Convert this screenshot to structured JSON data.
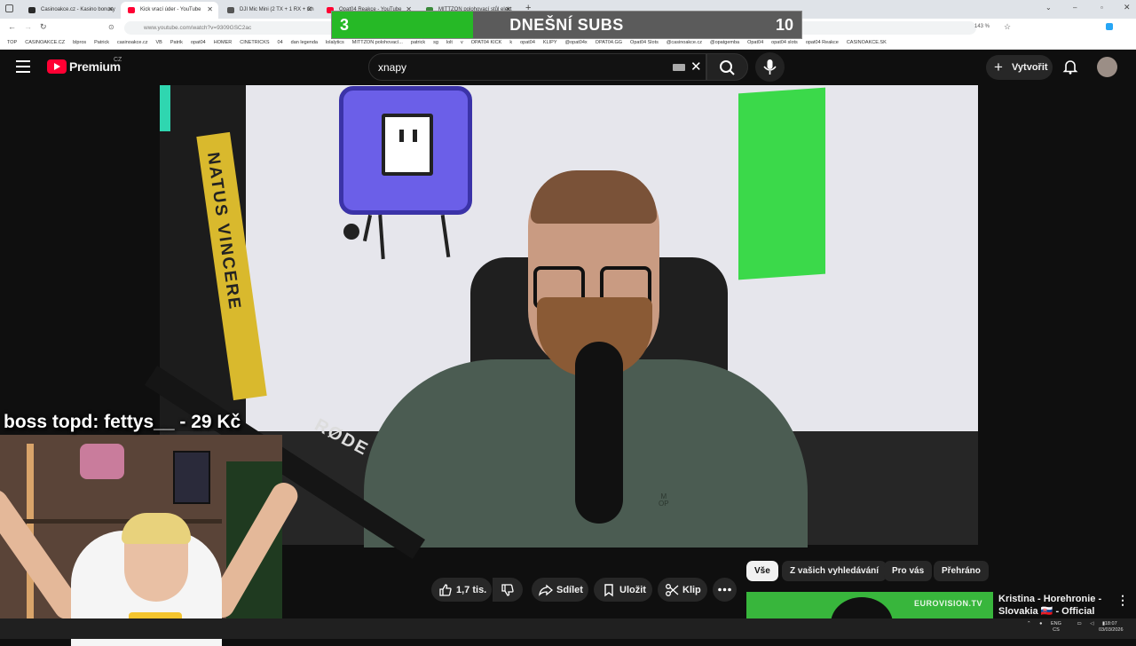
{
  "browser": {
    "tabs": [
      {
        "label": "Casinoakce.cz - Kasino bonusy",
        "color": "#2a2a2a"
      },
      {
        "label": "Kick vrací úder - YouTube",
        "color": "#ff0033"
      },
      {
        "label": "DJI Mic Mini (2 TX + 1 RX + Ch",
        "color": "#555555"
      },
      {
        "label": "Opat04 Reakce - YouTube",
        "color": "#ff0033"
      },
      {
        "label": "MITTZON polohovací stůl elekt",
        "color": "#3a8a3a"
      }
    ],
    "url": "www.youtube.com/watch?v=9309GSC2ac",
    "zoom": "143 %",
    "bookmarks": [
      "TOP",
      "CASINOAKCE.CZ",
      "blpros",
      "Patrick",
      "casinoakce.cz",
      "VB",
      "Patrik",
      "opat04",
      "HOMER",
      "CINETRICKS",
      "04",
      "dan legenda",
      "lolalytics",
      "MITTZON polohovací...",
      "patrick",
      "sg",
      "lolt",
      "v",
      "OPAT04 KICK",
      "k",
      "opat04",
      "KLIPY",
      "@opat04x",
      "OPAT04.GG",
      "Opat04 Slots",
      "@casinoakce.cz",
      "@opatgemba",
      "Opat04",
      "opat04 slots",
      "opat04 Reakce",
      "CASINOAKCE.SK"
    ]
  },
  "overlay": {
    "current": "3",
    "title": "DNEŠNÍ SUBS",
    "goal": "10",
    "progress_fraction": 0.3,
    "progress_color": "#26b926",
    "donation": "boss topd:  fettys__ - 29 Kč"
  },
  "youtube": {
    "brand": "Premium",
    "region": "CZ",
    "search_value": "xnapy",
    "create_label": "Vytvořit",
    "actions": {
      "likes": "1,7 tis.",
      "share": "Sdílet",
      "save": "Uložit",
      "clip": "Klip"
    },
    "chips": [
      "Vše",
      "Z vašich vyhledávání",
      "Pro vás",
      "Přehráno"
    ],
    "recommended": {
      "title": "Kristina - Horehronie - Slovakia 🇸🇰 - Official Music...",
      "channel_watermark": "EUROVISION.TV"
    }
  },
  "video": {
    "tape_text": "NATUS VINCERE",
    "mic_brand": "RØDE",
    "shirt_logo": "M\nOP"
  },
  "taskbar": {
    "lang_top": "ENG",
    "lang_bottom": "CS",
    "time": "18:07",
    "date": "03/03/2026"
  }
}
